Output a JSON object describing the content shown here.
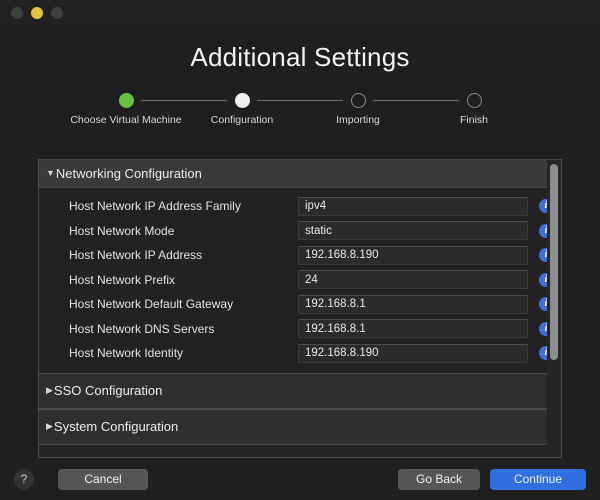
{
  "window": {
    "title": "Additional Settings",
    "traffic_lights": [
      {
        "name": "close",
        "color": "#3e3e3e"
      },
      {
        "name": "minimize",
        "color": "#e4c13d"
      },
      {
        "name": "zoom",
        "color": "#3e3e3e"
      }
    ]
  },
  "stepper": {
    "steps": [
      {
        "label": "Choose Virtual Machine",
        "state": "done"
      },
      {
        "label": "Configuration",
        "state": "current"
      },
      {
        "label": "Importing",
        "state": "todo"
      },
      {
        "label": "Finish",
        "state": "todo"
      }
    ],
    "done_color": "#69c040",
    "current_color": "#f0f0f0",
    "todo_color": "#8a8a8a"
  },
  "sections": [
    {
      "title": "Networking Configuration",
      "expanded": true,
      "triangle": "▼",
      "rows": [
        {
          "label": "Host Network IP Address Family",
          "value": "ipv4"
        },
        {
          "label": "Host Network Mode",
          "value": "static"
        },
        {
          "label": "Host Network IP Address",
          "value": "192.168.8.190"
        },
        {
          "label": "Host Network Prefix",
          "value": "24"
        },
        {
          "label": "Host Network Default Gateway",
          "value": "192.168.8.1"
        },
        {
          "label": "Host Network DNS Servers",
          "value": "192.168.8.1"
        },
        {
          "label": "Host Network Identity",
          "value": "192.168.8.190"
        }
      ]
    },
    {
      "title": "SSO Configuration",
      "expanded": false,
      "triangle": "▶",
      "rows": []
    },
    {
      "title": "System Configuration",
      "expanded": false,
      "triangle": "▶",
      "rows": []
    }
  ],
  "info_icon_glyph": "i",
  "footer": {
    "help_label": "?",
    "cancel_label": "Cancel",
    "go_back_label": "Go Back",
    "continue_label": "Continue",
    "accent_color": "#2f6fe0"
  }
}
